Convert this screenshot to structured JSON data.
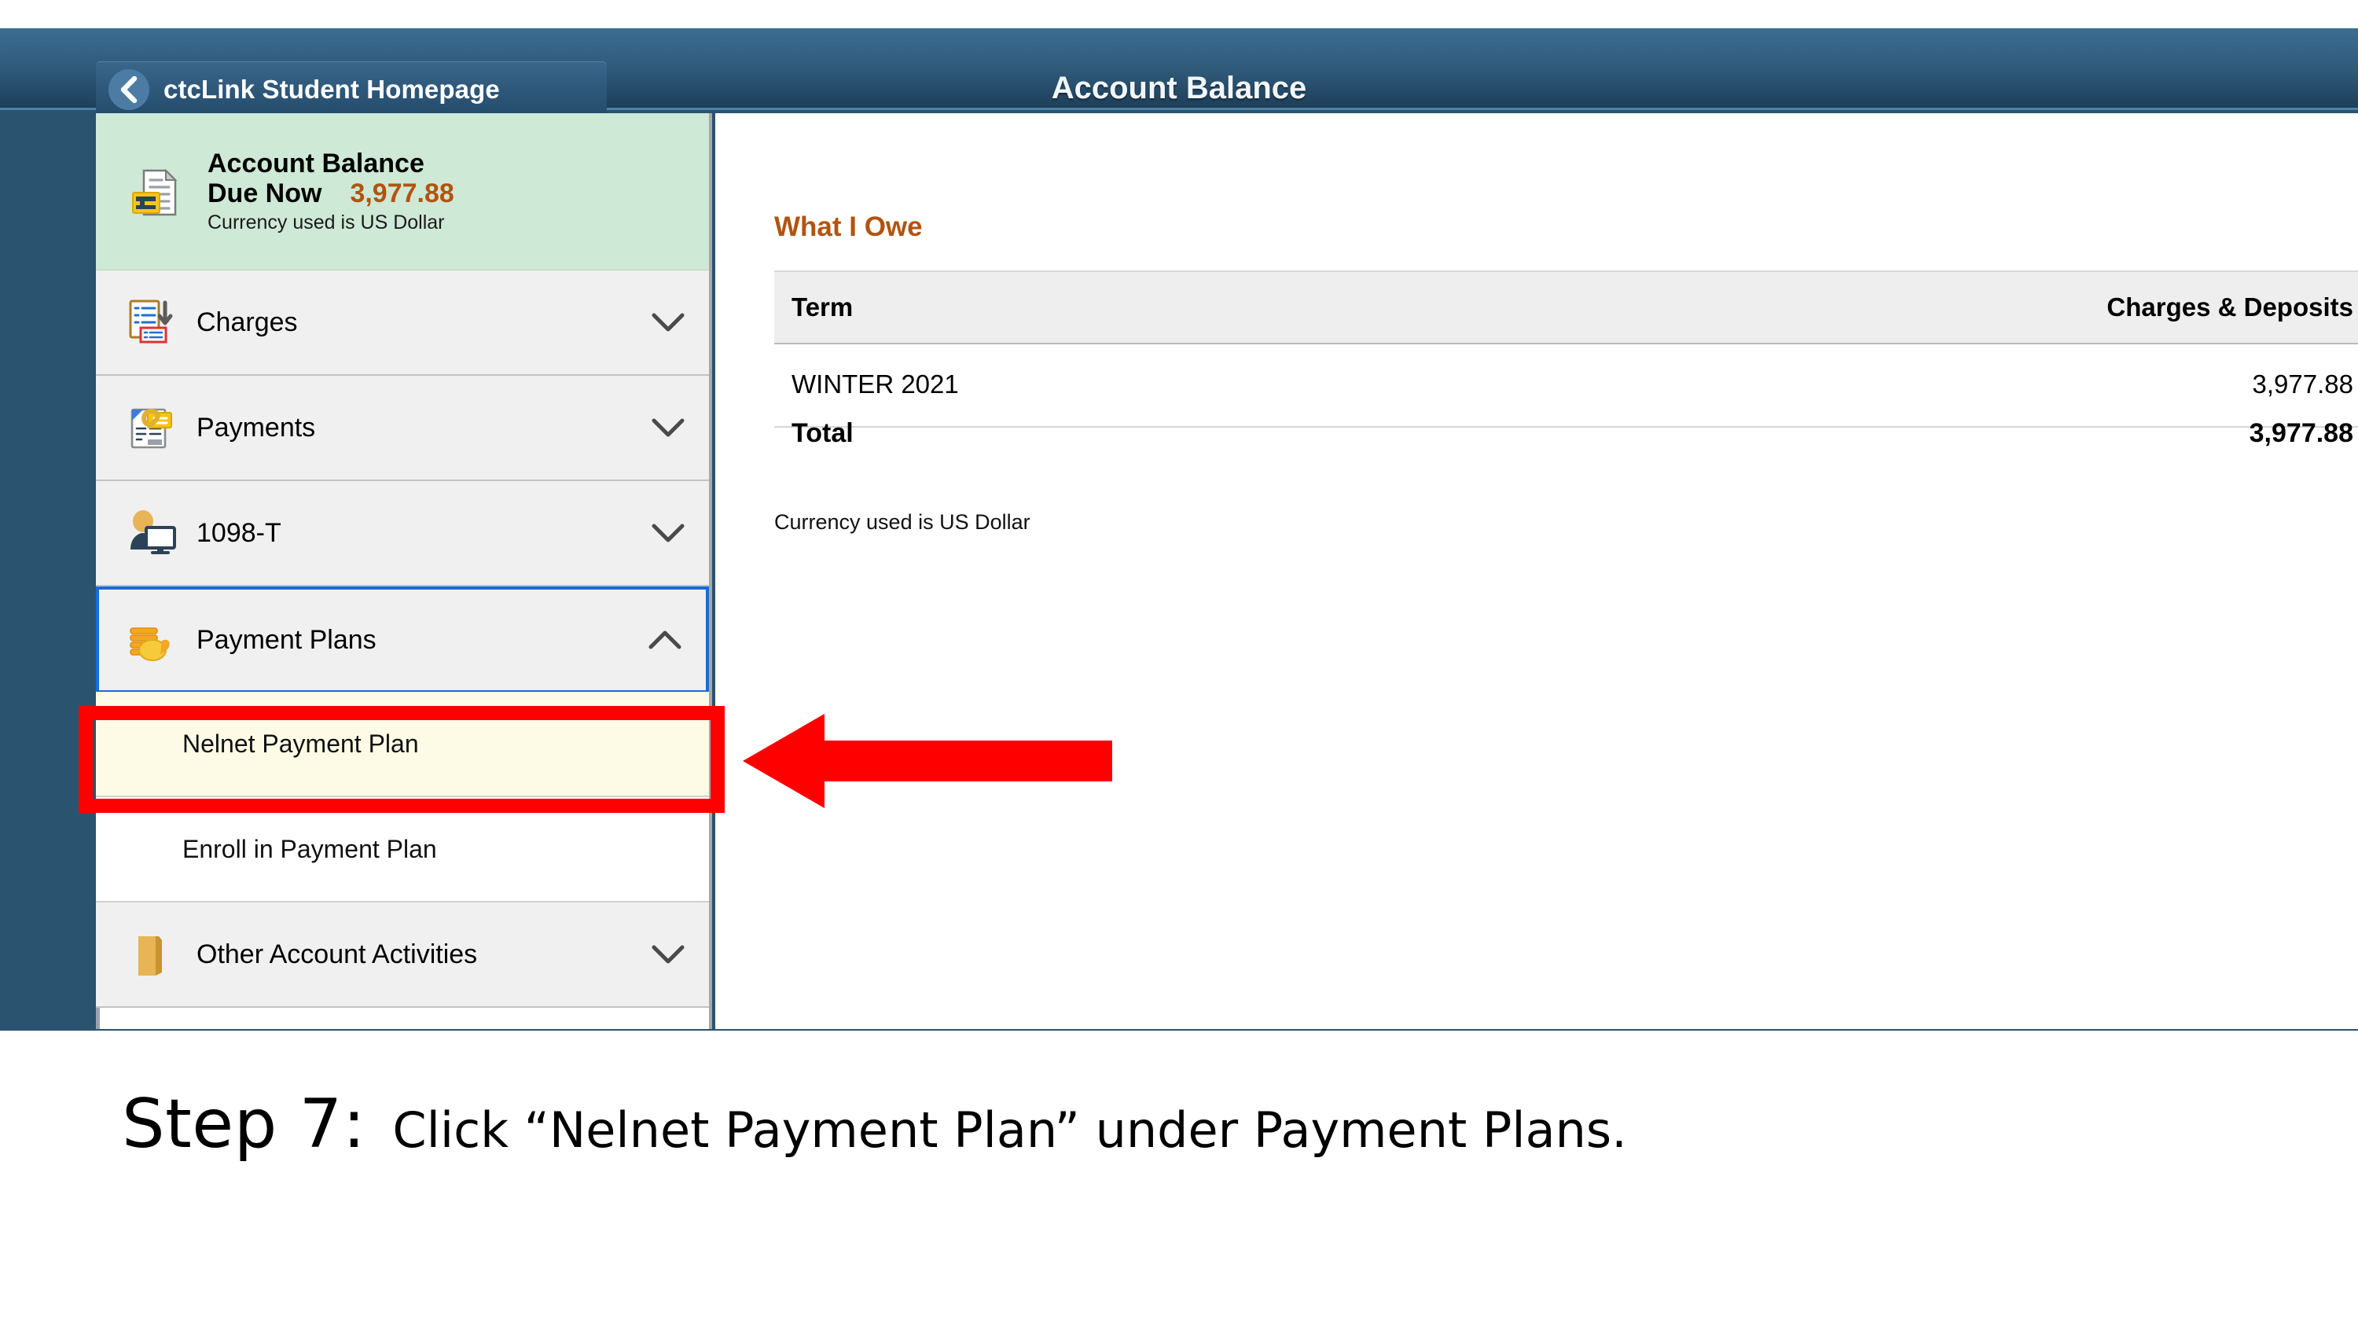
{
  "header": {
    "back_label": "ctcLink Student Homepage",
    "back_icon": "chevron-left-icon",
    "title": "Account Balance"
  },
  "sidebar": {
    "balance_card": {
      "icon": "invoice-document-icon",
      "title": "Account Balance",
      "due_label": "Due Now",
      "due_amount": "3,977.88",
      "currency_note": "Currency used is US Dollar"
    },
    "items": [
      {
        "label": "Charges",
        "icon": "charges-list-icon",
        "chevron": "chevron-down-icon",
        "expanded": false
      },
      {
        "label": "Payments",
        "icon": "payments-clip-icon",
        "chevron": "chevron-down-icon",
        "expanded": false
      },
      {
        "label": "1098-T",
        "icon": "user-monitor-icon",
        "chevron": "chevron-down-icon",
        "expanded": false
      },
      {
        "label": "Payment Plans",
        "icon": "coins-stack-icon",
        "chevron": "chevron-up-icon",
        "expanded": true
      },
      {
        "label": "Other Account Activities",
        "icon": "folder-icon",
        "chevron": "chevron-down-icon",
        "expanded": false
      }
    ],
    "sub_items": [
      {
        "label": "Nelnet Payment Plan",
        "highlighted": true
      },
      {
        "label": "Enroll in Payment Plan",
        "highlighted": false
      }
    ]
  },
  "main": {
    "section_title": "What I Owe",
    "table": {
      "columns": [
        "Term",
        "Charges & Deposits"
      ],
      "rows": [
        {
          "term": "WINTER 2021",
          "amount": "3,977.88"
        }
      ]
    },
    "total_label": "Total",
    "total_amount": "3,977.88",
    "currency_note": "Currency used is US Dollar"
  },
  "annotation": {
    "highlight_color": "#ff0000",
    "arrow_icon": "left-arrow-annotation",
    "target": "Nelnet Payment Plan"
  },
  "caption": {
    "step": "Step 7:",
    "text": "Click “Nelnet Payment Plan” under Payment Plans."
  },
  "colors": {
    "header_navy": "#2e5878",
    "balance_green": "#cee9d6",
    "accent_orange": "#b3530f",
    "focus_blue": "#1a6bd4",
    "highlight_yellow": "#fdfbe6"
  }
}
